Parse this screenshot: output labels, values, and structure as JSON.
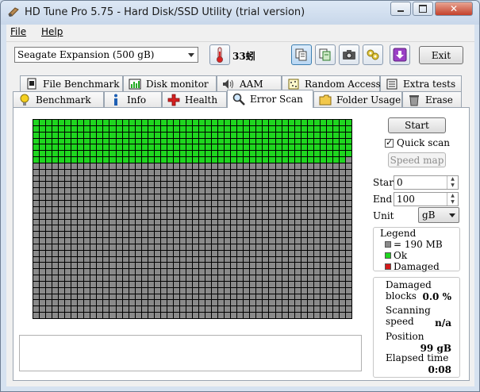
{
  "window": {
    "title": "HD Tune Pro 5.75 - Hard Disk/SSD Utility (trial version)"
  },
  "menu": {
    "file": "File",
    "help": "Help"
  },
  "toolbar": {
    "drive": "Seagate Expansion (500 gB)",
    "temperature": "33",
    "temperature_unit": "蚓",
    "exit_label": "Exit"
  },
  "tabs_row1": [
    {
      "label": "File Benchmark",
      "icon": "file-benchmark-icon"
    },
    {
      "label": "Disk monitor",
      "icon": "disk-monitor-icon"
    },
    {
      "label": "AAM",
      "icon": "speaker-icon"
    },
    {
      "label": "Random Access",
      "icon": "random-access-icon"
    },
    {
      "label": "Extra tests",
      "icon": "extra-tests-icon"
    }
  ],
  "tabs_row2": [
    {
      "label": "Benchmark",
      "icon": "lightbulb-icon"
    },
    {
      "label": "Info",
      "icon": "info-icon"
    },
    {
      "label": "Health",
      "icon": "health-cross-icon"
    },
    {
      "label": "Error Scan",
      "icon": "magnifier-icon",
      "selected": true
    },
    {
      "label": "Folder Usage",
      "icon": "folder-icon"
    },
    {
      "label": "Erase",
      "icon": "trash-icon"
    }
  ],
  "scan": {
    "start_button": "Start",
    "quick_scan_label": "Quick scan",
    "quick_scan_checked": true,
    "speed_map_button": "Speed map",
    "start_label": "Start",
    "start_value": "0",
    "end_label": "End",
    "end_value": "100",
    "unit_label": "Unit",
    "unit_value": "gB",
    "grid_columns": 50,
    "grid_rows": 32,
    "scanned_rows_full": 6,
    "scanned_extra_blocks": 49
  },
  "legend": {
    "title": "Legend",
    "items": [
      {
        "label": "= 190 MB",
        "color": "#8a8a8a"
      },
      {
        "label": "Ok",
        "color": "#1fd61f"
      },
      {
        "label": "Damaged",
        "color": "#d41a1a"
      }
    ]
  },
  "stats": {
    "damaged_blocks_label": "Damaged blocks",
    "damaged_blocks_value": "0.0",
    "damaged_blocks_unit": "%",
    "scanning_speed_label": "Scanning speed",
    "scanning_speed_value": "n/a",
    "position_label": "Position",
    "position_value": "99 gB",
    "elapsed_label": "Elapsed time",
    "elapsed_value": "0:08"
  }
}
